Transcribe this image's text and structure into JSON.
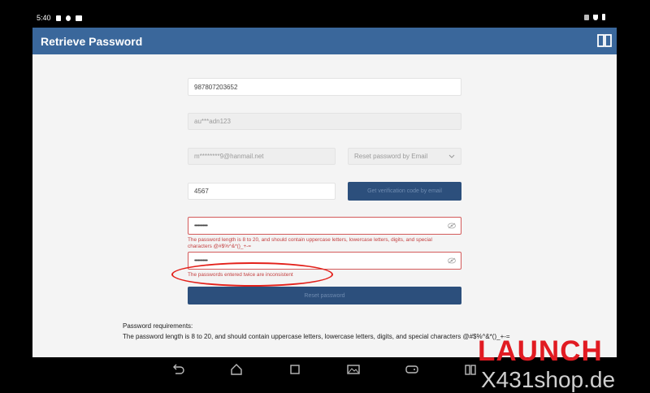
{
  "status_bar": {
    "time": "5:40"
  },
  "header": {
    "title": "Retrieve Password"
  },
  "form": {
    "phone_value": "987807203652",
    "username_value": "au***adn123",
    "email_value": "m********9@hanmail.net",
    "reset_method": "Reset password by Email",
    "code_value": "4567",
    "get_code_label": "Get verification code by email",
    "password_dots": "•••••••••••",
    "password_error": "The password length is 8 to 20, and should contain uppercase letters, lowercase letters, digits, and special characters @#$%^&*()_+-=",
    "confirm_dots": "•••••••••••",
    "confirm_error": "The passwords entered twice are inconsistent",
    "reset_button_label": "Reset password"
  },
  "requirements": {
    "heading": "Password requirements:",
    "text": "The password length is 8 to 20, and should contain uppercase letters, lowercase letters, digits, and special characters @#$%^&*()_+-="
  },
  "watermark": {
    "brand": "LAUNCH",
    "site": "X431shop.de"
  },
  "colors": {
    "header": "#3a679b",
    "button": "#2c4f7c",
    "error": "#c44040",
    "annotation": "#e3211b",
    "brand": "#e11b22"
  }
}
